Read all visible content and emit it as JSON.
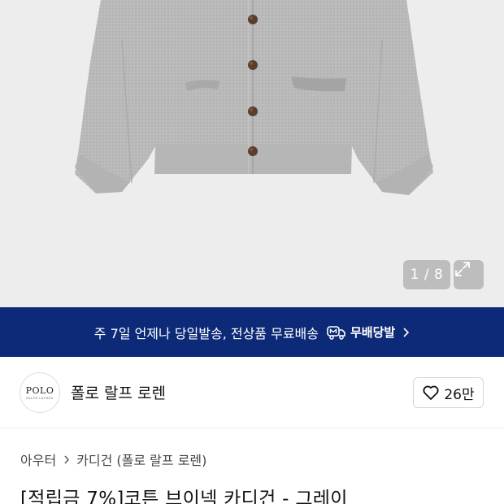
{
  "gallery": {
    "image_description_icon": "cardigan-product-image",
    "counter": "1 / 8",
    "expand_icon": "expand-icon"
  },
  "shipping_banner": {
    "text": "주 7일 언제나 당일발송, 전상품 무료배송",
    "brand_label": "무배당발",
    "icon": "delivery-truck-icon",
    "background": "#0c2a78"
  },
  "brand": {
    "logo_main": "POLO",
    "logo_sub": "RALPH LAUREN",
    "name": "폴로 랄프 로렌",
    "likes": "26만"
  },
  "breadcrumb": {
    "items": [
      "아우터",
      "카디건 (폴로 랄프 로렌)"
    ]
  },
  "product": {
    "title": "[적립금 7%]코튼 브이넥 카디건 - 그레이"
  }
}
